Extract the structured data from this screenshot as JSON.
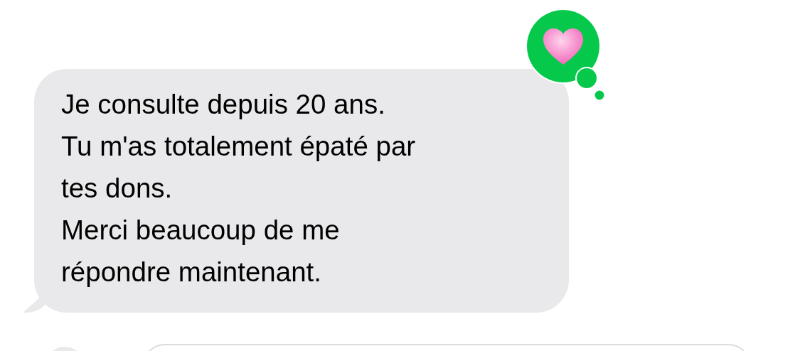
{
  "message": {
    "text": "Je consulte depuis 20 ans.\nTu m'as totalement épaté par\ntes dons.\nMerci beaucoup de me\nrépondre maintenant.",
    "reaction": {
      "kind": "heart"
    }
  },
  "composer": {
    "kind": "field"
  }
}
